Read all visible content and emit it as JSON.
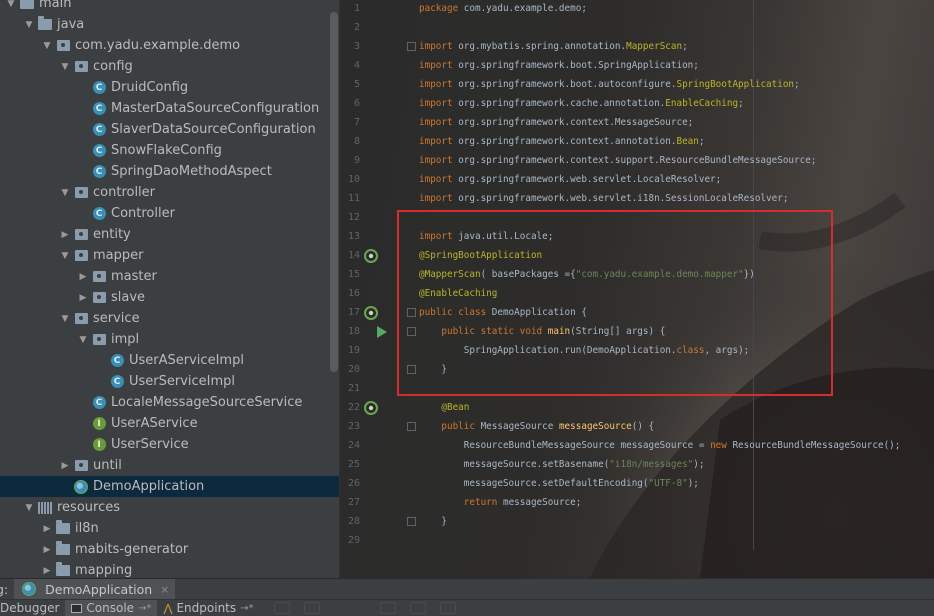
{
  "tree": {
    "rows": [
      {
        "label": "main",
        "depth": 0,
        "arrow": "down",
        "icon": "folder"
      },
      {
        "label": "java",
        "depth": 1,
        "arrow": "down",
        "icon": "folder"
      },
      {
        "label": "com.yadu.example.demo",
        "depth": 2,
        "arrow": "down",
        "icon": "package"
      },
      {
        "label": "config",
        "depth": 3,
        "arrow": "down",
        "icon": "package"
      },
      {
        "label": "DruidConfig",
        "depth": 4,
        "arrow": "",
        "icon": "class"
      },
      {
        "label": "MasterDataSourceConfiguration",
        "depth": 4,
        "arrow": "",
        "icon": "class"
      },
      {
        "label": "SlaverDataSourceConfiguration",
        "depth": 4,
        "arrow": "",
        "icon": "class"
      },
      {
        "label": "SnowFlakeConfig",
        "depth": 4,
        "arrow": "",
        "icon": "class"
      },
      {
        "label": "SpringDaoMethodAspect",
        "depth": 4,
        "arrow": "",
        "icon": "class"
      },
      {
        "label": "controller",
        "depth": 3,
        "arrow": "down",
        "icon": "package"
      },
      {
        "label": "Controller",
        "depth": 4,
        "arrow": "",
        "icon": "class"
      },
      {
        "label": "entity",
        "depth": 3,
        "arrow": "right",
        "icon": "package"
      },
      {
        "label": "mapper",
        "depth": 3,
        "arrow": "down",
        "icon": "package"
      },
      {
        "label": "master",
        "depth": 4,
        "arrow": "right",
        "icon": "package"
      },
      {
        "label": "slave",
        "depth": 4,
        "arrow": "right",
        "icon": "package"
      },
      {
        "label": "service",
        "depth": 3,
        "arrow": "down",
        "icon": "package"
      },
      {
        "label": "impl",
        "depth": 4,
        "arrow": "down",
        "icon": "package"
      },
      {
        "label": "UserAServiceImpl",
        "depth": 5,
        "arrow": "",
        "icon": "class"
      },
      {
        "label": "UserServiceImpl",
        "depth": 5,
        "arrow": "",
        "icon": "class"
      },
      {
        "label": "LocaleMessageSourceService",
        "depth": 4,
        "arrow": "",
        "icon": "class"
      },
      {
        "label": "UserAService",
        "depth": 4,
        "arrow": "",
        "icon": "interface"
      },
      {
        "label": "UserService",
        "depth": 4,
        "arrow": "",
        "icon": "interface"
      },
      {
        "label": "until",
        "depth": 3,
        "arrow": "right",
        "icon": "package"
      },
      {
        "label": "DemoApplication",
        "depth": 3,
        "arrow": "",
        "icon": "spring-app",
        "selected": true
      },
      {
        "label": "resources",
        "depth": 1,
        "arrow": "down",
        "icon": "resources"
      },
      {
        "label": "il8n",
        "depth": 2,
        "arrow": "right",
        "icon": "folder"
      },
      {
        "label": "mabits-generator",
        "depth": 2,
        "arrow": "right",
        "icon": "folder"
      },
      {
        "label": "mapping",
        "depth": 2,
        "arrow": "right",
        "icon": "folder"
      }
    ]
  },
  "editor": {
    "lines": [
      {
        "n": "1",
        "tokens": [
          [
            "kw",
            "package "
          ],
          [
            "pc",
            "com.yadu.example.demo;"
          ]
        ]
      },
      {
        "n": "2",
        "tokens": []
      },
      {
        "n": "3",
        "tokens": [
          [
            "kw",
            "import "
          ],
          [
            "pc",
            "org.mybatis.spring.annotation."
          ],
          [
            "an",
            "MapperScan"
          ],
          [
            "pc",
            ";"
          ]
        ]
      },
      {
        "n": "4",
        "tokens": [
          [
            "kw",
            "import "
          ],
          [
            "pc",
            "org.springframework.boot.SpringApplication;"
          ]
        ]
      },
      {
        "n": "5",
        "tokens": [
          [
            "kw",
            "import "
          ],
          [
            "pc",
            "org.springframework.boot.autoconfigure."
          ],
          [
            "an",
            "SpringBootApplication"
          ],
          [
            "pc",
            ";"
          ]
        ]
      },
      {
        "n": "6",
        "tokens": [
          [
            "kw",
            "import "
          ],
          [
            "pc",
            "org.springframework.cache.annotation."
          ],
          [
            "an",
            "EnableCaching"
          ],
          [
            "pc",
            ";"
          ]
        ]
      },
      {
        "n": "7",
        "tokens": [
          [
            "kw",
            "import "
          ],
          [
            "pc",
            "org.springframework.context.MessageSource;"
          ]
        ]
      },
      {
        "n": "8",
        "tokens": [
          [
            "kw",
            "import "
          ],
          [
            "pc",
            "org.springframework.context.annotation."
          ],
          [
            "an",
            "Bean"
          ],
          [
            "pc",
            ";"
          ]
        ]
      },
      {
        "n": "9",
        "tokens": [
          [
            "kw",
            "import "
          ],
          [
            "pc",
            "org.springframework.context.support.ResourceBundleMessageSource;"
          ]
        ]
      },
      {
        "n": "10",
        "tokens": [
          [
            "kw",
            "import "
          ],
          [
            "pc",
            "org.springframework.web.servlet.LocaleResolver;"
          ]
        ]
      },
      {
        "n": "11",
        "tokens": [
          [
            "kw",
            "import "
          ],
          [
            "pc",
            "org.springframework.web.servlet.i18n.SessionLocaleResolver;"
          ]
        ]
      },
      {
        "n": "12",
        "tokens": []
      },
      {
        "n": "13",
        "tokens": [
          [
            "kw",
            "import "
          ],
          [
            "pc",
            "java.util.Locale;"
          ]
        ]
      },
      {
        "n": "14",
        "tokens": [
          [
            "an",
            "@SpringBootApplication"
          ]
        ]
      },
      {
        "n": "15",
        "tokens": [
          [
            "an",
            "@MapperScan"
          ],
          [
            "pc",
            "( basePackages ={"
          ],
          [
            "st",
            "\"com.yadu.example.demo.mapper\""
          ],
          [
            "pc",
            "})"
          ]
        ]
      },
      {
        "n": "16",
        "tokens": [
          [
            "an",
            "@EnableCaching"
          ]
        ]
      },
      {
        "n": "17",
        "tokens": [
          [
            "kw",
            "public class "
          ],
          [
            "pc",
            "DemoApplication {"
          ]
        ]
      },
      {
        "n": "18",
        "tokens": [
          [
            "pc",
            "    "
          ],
          [
            "kw",
            "public static void "
          ],
          [
            "nm",
            "main"
          ],
          [
            "pc",
            "(String[] args) {"
          ]
        ]
      },
      {
        "n": "19",
        "tokens": [
          [
            "pc",
            "        SpringApplication."
          ],
          [
            "pc",
            "run"
          ],
          [
            "pc",
            "(DemoApplication."
          ],
          [
            "kw",
            "class"
          ],
          [
            "pc",
            ", args);"
          ]
        ]
      },
      {
        "n": "20",
        "tokens": [
          [
            "pc",
            "    }"
          ]
        ]
      },
      {
        "n": "21",
        "tokens": []
      },
      {
        "n": "22",
        "tokens": [
          [
            "pc",
            "    "
          ],
          [
            "an",
            "@Bean"
          ]
        ]
      },
      {
        "n": "23",
        "tokens": [
          [
            "pc",
            "    "
          ],
          [
            "kw",
            "public "
          ],
          [
            "pc",
            "MessageSource "
          ],
          [
            "nm",
            "messageSource"
          ],
          [
            "pc",
            "() {"
          ]
        ]
      },
      {
        "n": "24",
        "tokens": [
          [
            "pc",
            "        ResourceBundleMessageSource messageSource = "
          ],
          [
            "kw",
            "new "
          ],
          [
            "pc",
            "ResourceBundleMessageSource();"
          ]
        ]
      },
      {
        "n": "25",
        "tokens": [
          [
            "pc",
            "        messageSource.setBasename("
          ],
          [
            "st",
            "\"i18n/messages\""
          ],
          [
            "pc",
            ");"
          ]
        ]
      },
      {
        "n": "26",
        "tokens": [
          [
            "pc",
            "        messageSource.setDefaultEncoding("
          ],
          [
            "st",
            "\"UTF-8\""
          ],
          [
            "pc",
            ");"
          ]
        ]
      },
      {
        "n": "27",
        "tokens": [
          [
            "pc",
            "        "
          ],
          [
            "kw",
            "return "
          ],
          [
            "pc",
            "messageSource;"
          ]
        ]
      },
      {
        "n": "28",
        "tokens": [
          [
            "pc",
            "    }"
          ]
        ]
      },
      {
        "n": "29",
        "tokens": []
      }
    ]
  },
  "runbar": {
    "label": "g:",
    "tab_label": "DemoApplication",
    "close": "×"
  },
  "toolbar": {
    "tabs": [
      {
        "label": "Debugger",
        "icon": "debugger-icon"
      },
      {
        "label": "Console",
        "icon": "console-icon",
        "pin": "→*"
      },
      {
        "label": "Endpoints",
        "icon": "endpoints-icon",
        "pin": "→*"
      }
    ]
  },
  "colors": {
    "selection": "#0d293e",
    "annotation_box": "#d52d2d",
    "keyword": "#cc7832",
    "annotation": "#bbb529",
    "string": "#6a8759"
  }
}
